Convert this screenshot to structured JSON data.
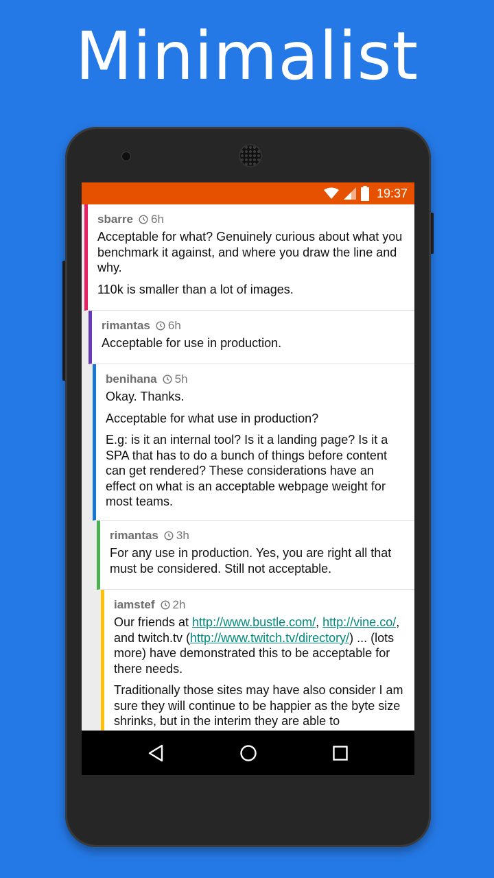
{
  "headline": "Minimalist",
  "status_bar": {
    "time": "19:37",
    "icons": [
      "wifi-icon",
      "signal-icon",
      "battery-icon"
    ]
  },
  "thread_colors": [
    "#e91e63",
    "#673ab7",
    "#1976d2",
    "#4caf50",
    "#ffc107"
  ],
  "comments": [
    {
      "author": "sbarre",
      "age": "6h",
      "paragraphs": [
        "Acceptable for what? Genuinely curious about what you benchmark it against, and where you draw the line and why.",
        "110k is smaller than a lot of images."
      ]
    },
    {
      "author": "rimantas",
      "age": "6h",
      "paragraphs": [
        "Acceptable for use in production."
      ]
    },
    {
      "author": "benihana",
      "age": "5h",
      "paragraphs": [
        "Okay. Thanks.",
        "Acceptable for what use in production?",
        "E.g: is it an internal tool? Is it a landing page? Is it a SPA that has to do a bunch of things before content can get rendered? These considerations have an effect on what is an acceptable webpage weight for most teams."
      ]
    },
    {
      "author": "rimantas",
      "age": "3h",
      "paragraphs": [
        "For any use in production. Yes, you are right all that must be considered. Still not acceptable."
      ]
    },
    {
      "author": "iamstef",
      "age": "2h",
      "p1": {
        "before": "Our friends at ",
        "link1": "http://www.bustle.com/",
        "sep1": ", ",
        "link2": "http://vine.co/",
        "sep2": ", and twitch.tv (",
        "link3": "http://www.twitch.tv/directory/",
        "after": ") ... (lots more) have demonstrated this to be acceptable for there needs."
      },
      "p2": "Traditionally those sites may have also consider I am sure they will continue to be happier as the byte size shrinks, but in the interim they are able to"
    }
  ],
  "nav": {
    "icons": [
      "back-icon",
      "home-icon",
      "recents-icon"
    ]
  }
}
